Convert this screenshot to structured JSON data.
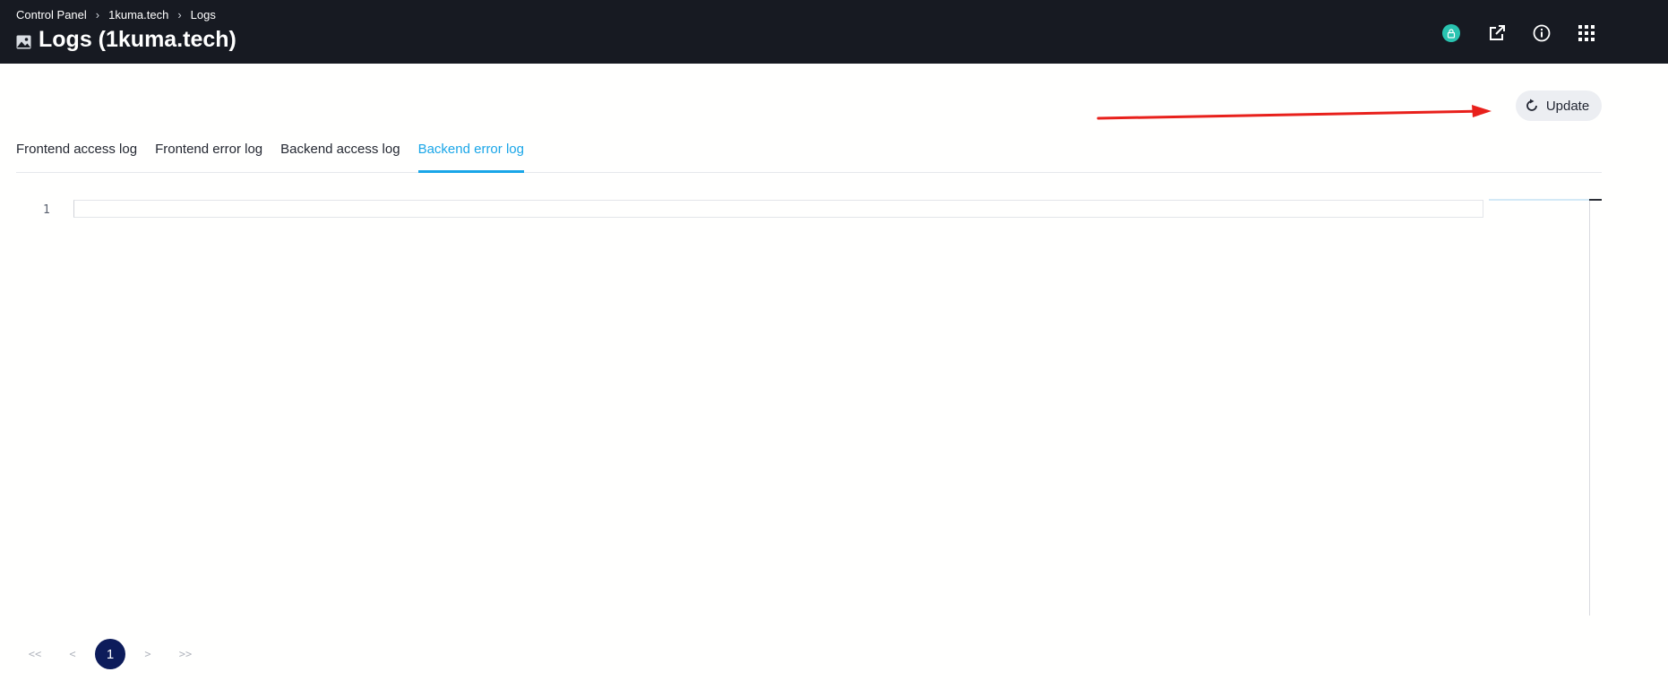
{
  "header": {
    "breadcrumb": [
      {
        "label": "Control Panel"
      },
      {
        "label": "1kuma.tech"
      },
      {
        "label": "Logs"
      }
    ],
    "title": "Logs (1kuma.tech)",
    "actions": [
      {
        "icon": "lock-icon",
        "label": "ssl-status"
      },
      {
        "icon": "external-link-icon",
        "label": "open-site"
      },
      {
        "icon": "info-icon",
        "label": "info"
      },
      {
        "icon": "apps-grid-icon",
        "label": "apps"
      }
    ]
  },
  "toolbar": {
    "update_label": "Update"
  },
  "tabs": [
    {
      "label": "Frontend access log",
      "active": false
    },
    {
      "label": "Frontend error log",
      "active": false
    },
    {
      "label": "Backend access log",
      "active": false
    },
    {
      "label": "Backend error log",
      "active": true
    }
  ],
  "editor": {
    "lines": [
      {
        "number": "1",
        "text": ""
      }
    ]
  },
  "pagination": {
    "first": "<<",
    "prev": "<",
    "current": "1",
    "next": ">",
    "last": ">>"
  },
  "colors": {
    "topbar": "#171a22",
    "accent": "#1aa6e8",
    "annotation_arrow": "#e8201b",
    "pagination_current": "#0d1c5b",
    "ssl_badge": "#29c3b0"
  }
}
